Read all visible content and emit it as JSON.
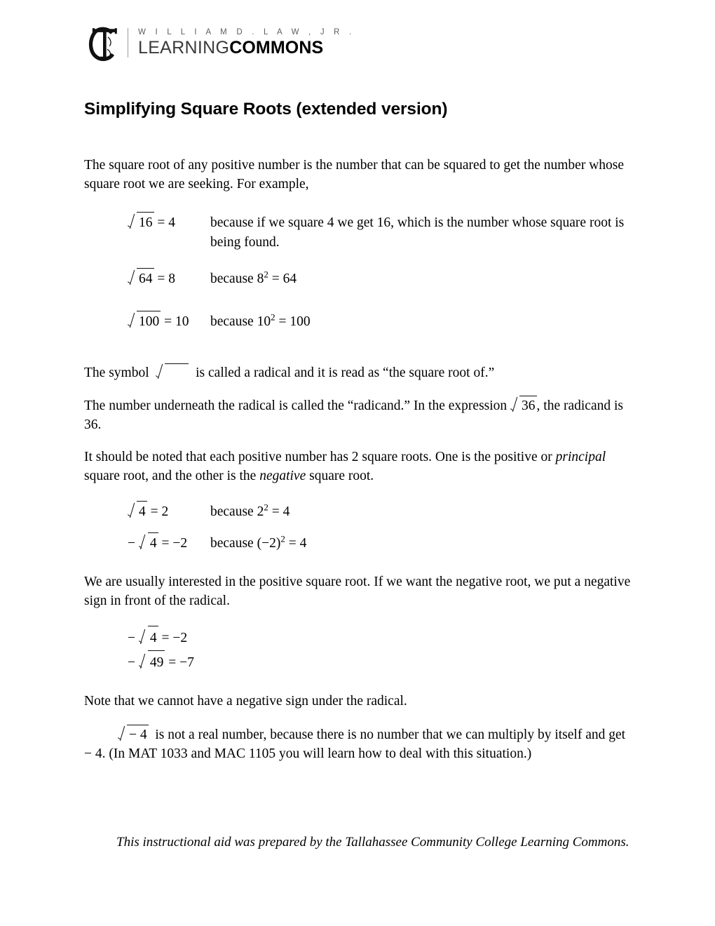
{
  "logo": {
    "mark_alt": "TC monogram",
    "line1": "W I L L I A M   D .   L A W ,   J R .",
    "learning": "LEARNING",
    "commons": "COMMONS",
    "divider_color": "#9a9a9a",
    "line1_color": "#5d5d5d"
  },
  "title": "Simplifying Square Roots (extended version)",
  "intro": "The square root of any positive number is the number that can be squared to get the number whose square root we are seeking.  For example,",
  "examples_1": [
    {
      "lhs_radicand": "16",
      "lhs_rest": "= 4",
      "rhs": "because if we square 4 we get 16, which is the number whose square root is being found."
    },
    {
      "lhs_radicand": "64",
      "lhs_rest": "= 8",
      "rhs_pre": "because 8",
      "rhs_sup": "2",
      "rhs_post": "= 64"
    },
    {
      "lhs_radicand": "100",
      "lhs_rest": "= 10",
      "rhs_pre": "because 10",
      "rhs_sup": "2",
      "rhs_post": "= 100"
    }
  ],
  "symbol_para": {
    "before": "The symbol",
    "after": "is called a radical and it is read as “the square root of.”"
  },
  "radicand_para": {
    "before": "The number underneath the radical is called the “radicand.”  In the expression",
    "radicand": "36",
    "after": ", the radicand is 36."
  },
  "two_roots_para": {
    "seg1": "It should be noted that each positive number has 2 square roots.  One is the positive or ",
    "em1": "principal",
    "seg2": " square root, and the other is the ",
    "em2": "negative",
    "seg3": " square root."
  },
  "examples_2": [
    {
      "lhs_neg": "",
      "lhs_radicand": "4",
      "lhs_rest": "= 2",
      "rhs_pre": "because 2",
      "rhs_sup": "2",
      "rhs_post": "= 4"
    },
    {
      "lhs_neg": "−",
      "lhs_radicand": "4",
      "lhs_rest": "= −2",
      "rhs_pre": "because (−2)",
      "rhs_sup": "2",
      "rhs_post": "= 4"
    }
  ],
  "positive_para": "We are usually interested in the positive square root.  If we want the negative root, we put a negative sign in front of the radical.",
  "examples_3": [
    {
      "lhs_neg": "−",
      "lhs_radicand": "4",
      "lhs_rest": "= −2"
    },
    {
      "lhs_neg": "−",
      "lhs_radicand": "49",
      "lhs_rest": "= −7"
    }
  ],
  "note_para": "Note that we cannot have a negative sign under the radical.",
  "final_para": {
    "radicand": "− 4",
    "after": "is not a real number, because there is no number that we can multiply by itself and get",
    "tail_value": "− 4",
    "tail": ".  (In MAT 1033 and MAC 1105 you will learn how to deal with this situation.)"
  },
  "footer": "This instructional aid was prepared by the Tallahassee Community College Learning Commons."
}
